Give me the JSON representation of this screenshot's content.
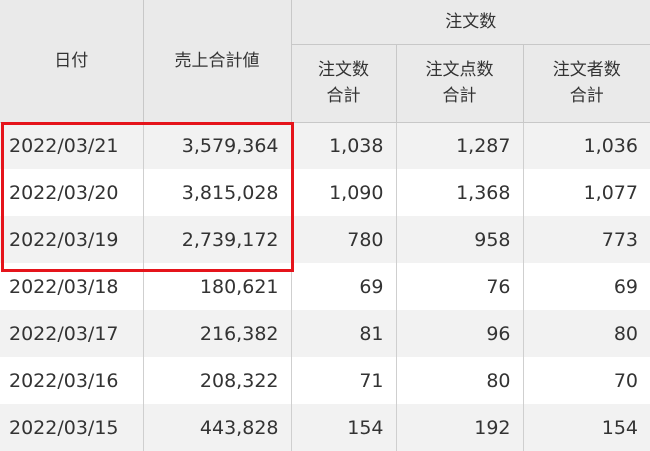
{
  "headers": {
    "date": "日付",
    "sales_total": "売上合計値",
    "orders_group": "注文数",
    "order_count_total": [
      "注文数",
      "合計"
    ],
    "item_count_total": [
      "注文点数",
      "合計"
    ],
    "customer_count_total": [
      "注文者数",
      "合計"
    ]
  },
  "rows": [
    {
      "date": "2022/03/21",
      "sales": "3,579,364",
      "orders": "1,038",
      "items": "1,287",
      "customers": "1,036"
    },
    {
      "date": "2022/03/20",
      "sales": "3,815,028",
      "orders": "1,090",
      "items": "1,368",
      "customers": "1,077"
    },
    {
      "date": "2022/03/19",
      "sales": "2,739,172",
      "orders": "780",
      "items": "958",
      "customers": "773"
    },
    {
      "date": "2022/03/18",
      "sales": "180,621",
      "orders": "69",
      "items": "76",
      "customers": "69"
    },
    {
      "date": "2022/03/17",
      "sales": "216,382",
      "orders": "81",
      "items": "96",
      "customers": "80"
    },
    {
      "date": "2022/03/16",
      "sales": "208,322",
      "orders": "71",
      "items": "80",
      "customers": "70"
    },
    {
      "date": "2022/03/15",
      "sales": "443,828",
      "orders": "154",
      "items": "192",
      "customers": "154"
    }
  ],
  "colors": {
    "header_bg": "#eaeaea",
    "stripe_bg": "#f2f2f2",
    "highlight": "#e5141b"
  }
}
